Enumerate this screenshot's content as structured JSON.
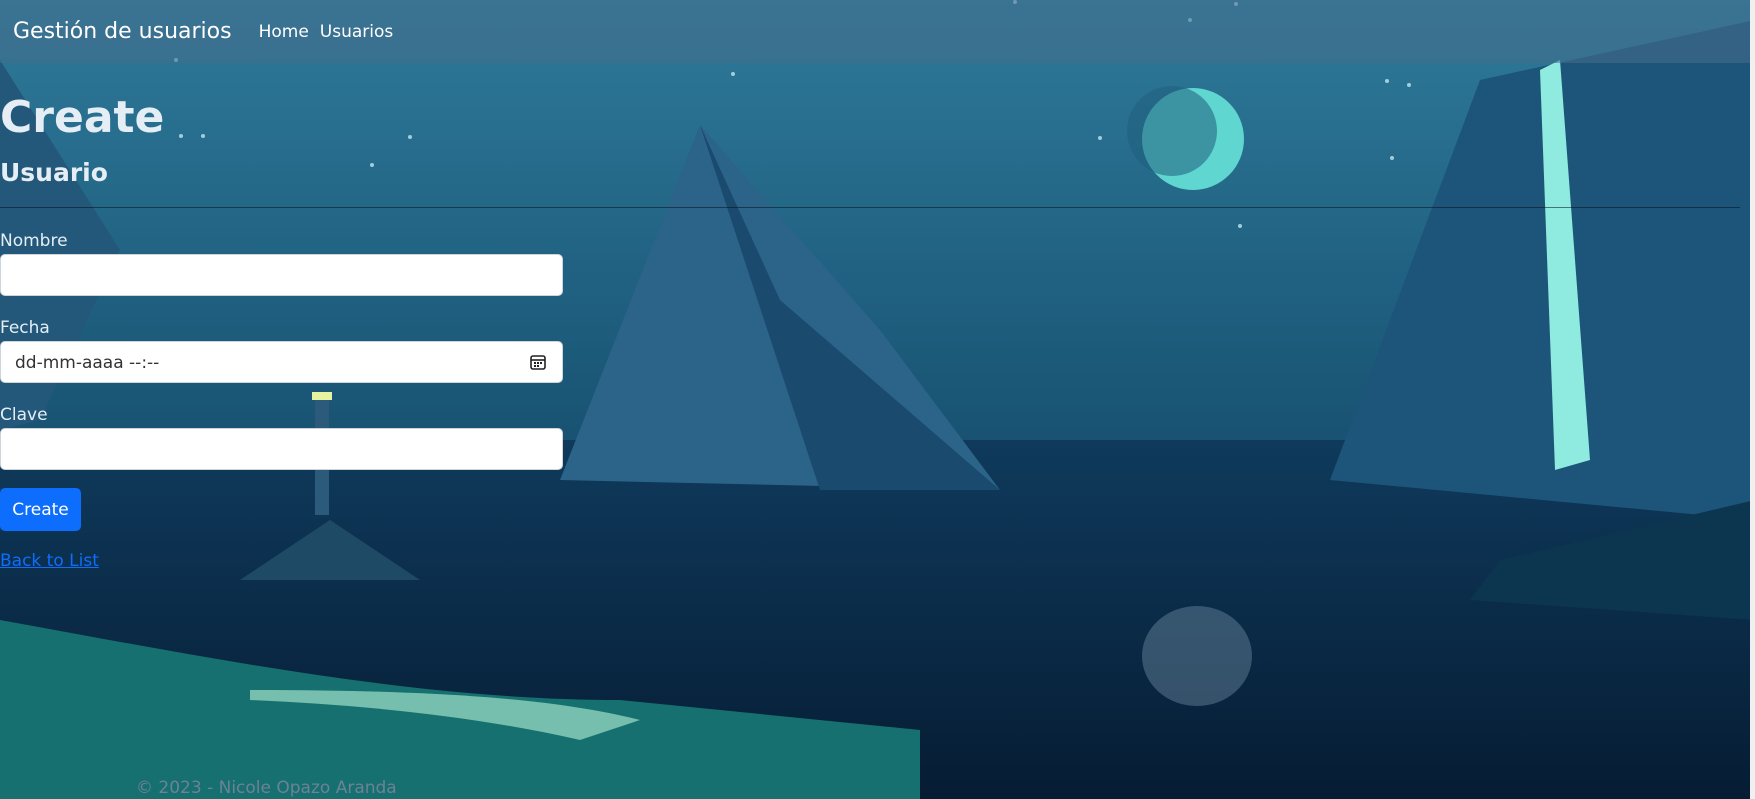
{
  "navbar": {
    "brand": "Gestión de usuarios",
    "links": [
      "Home",
      "Usuarios"
    ]
  },
  "page": {
    "title": "Create",
    "subtitle": "Usuario"
  },
  "form": {
    "nombre": {
      "label": "Nombre",
      "value": ""
    },
    "fecha": {
      "label": "Fecha",
      "placeholder": "dd-mm-aaaa --:--"
    },
    "clave": {
      "label": "Clave",
      "value": ""
    },
    "submit_label": "Create"
  },
  "back_link": "Back to List",
  "footer": "© 2023 - Nicole Opazo Aranda",
  "colors": {
    "accent": "#0d6efd",
    "navbar": "#466e8c",
    "background": "#0b2d4a"
  }
}
